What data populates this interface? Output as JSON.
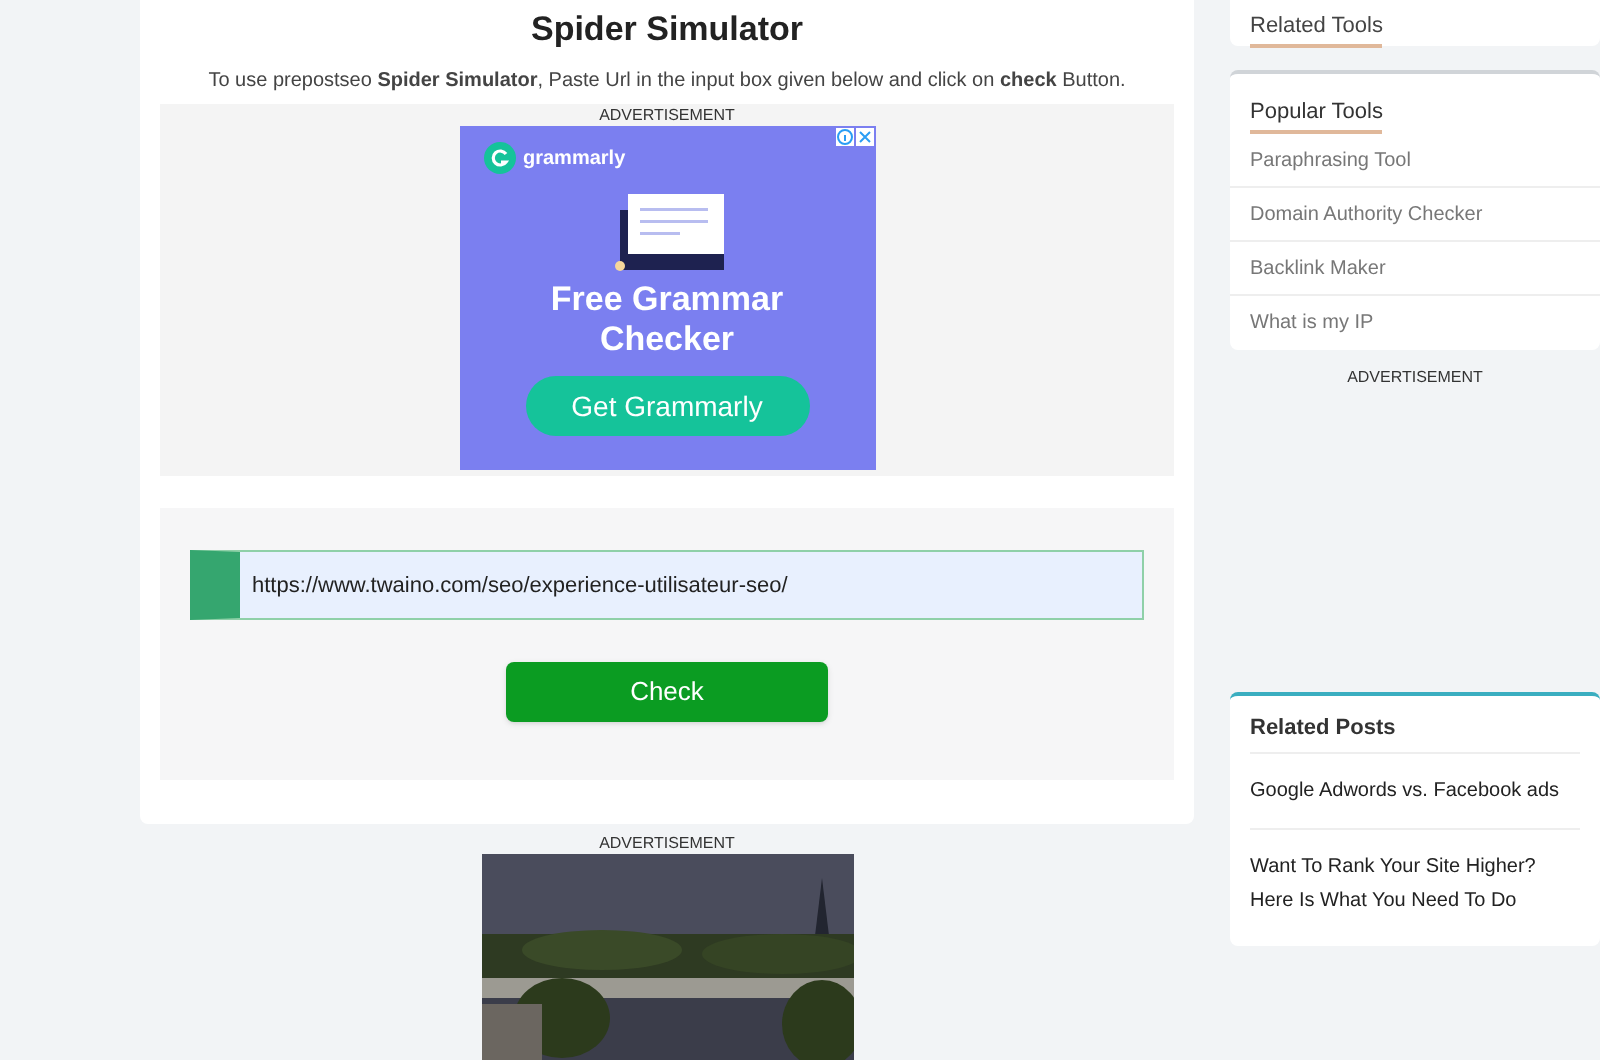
{
  "main": {
    "title": "Spider Simulator",
    "intro": "To use prepostseo **Spider Simulator**, Paste Url in the input box given below and click on **check** Button.",
    "ad_top": {
      "label": "ADVERTISEMENT",
      "brand": "grammarly",
      "headline": "Free Grammar Checker",
      "cta": "Get Grammarly"
    },
    "url_field": {
      "value": "https://www.twaino.com/seo/experience-utilisateur-seo/"
    },
    "check_button": "Check",
    "ad_bottom": {
      "label": "ADVERTISEMENT",
      "kind": "picture"
    }
  },
  "sidebar": {
    "related_tools": {
      "title": "Related Tools"
    },
    "popular_tools": {
      "title": "Popular Tools",
      "items": [
        "Paraphrasing Tool",
        "Domain Authority Checker",
        "Backlink Maker",
        "What is my IP"
      ]
    },
    "ad_label": "ADVERTISEMENT",
    "related_posts": {
      "title": "Related Posts",
      "items": [
        "Google Adwords vs. Facebook ads",
        "Want To Rank Your Site Higher? Here Is What You Need To Do"
      ]
    }
  }
}
